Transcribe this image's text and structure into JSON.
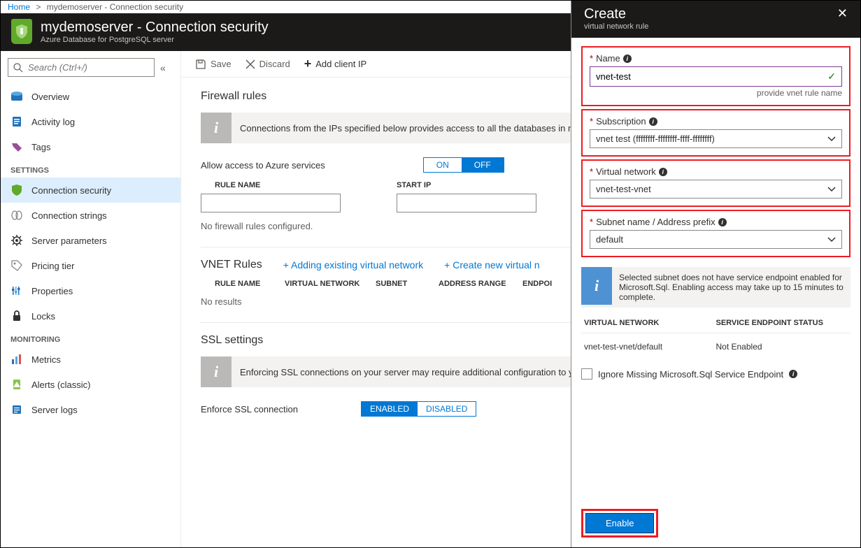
{
  "breadcrumb": {
    "home": "Home",
    "sep": ">",
    "current": "mydemoserver - Connection security"
  },
  "header": {
    "title": "mydemoserver - Connection security",
    "subtitle": "Azure Database for PostgreSQL server"
  },
  "search": {
    "placeholder": "Search (Ctrl+/)"
  },
  "nav": {
    "overview": "Overview",
    "activity": "Activity log",
    "tags": "Tags",
    "section_settings": "SETTINGS",
    "conn_sec": "Connection security",
    "conn_str": "Connection strings",
    "server_params": "Server parameters",
    "pricing": "Pricing tier",
    "properties": "Properties",
    "locks": "Locks",
    "section_monitoring": "MONITORING",
    "metrics": "Metrics",
    "alerts": "Alerts (classic)",
    "server_logs": "Server logs"
  },
  "toolbar": {
    "save": "Save",
    "discard": "Discard",
    "add_ip": "Add client IP"
  },
  "fw": {
    "title": "Firewall rules",
    "info": "Connections from the IPs specified below provides access to all the databases in my",
    "allow_azure": "Allow access to Azure services",
    "on": "ON",
    "off": "OFF",
    "col_rule": "RULE NAME",
    "col_start": "START IP",
    "none": "No firewall rules configured."
  },
  "vnet": {
    "title": "VNET Rules",
    "add_existing": "Adding existing virtual network",
    "create_new": "Create new virtual n",
    "col_rule": "RULE NAME",
    "col_vn": "VIRTUAL NETWORK",
    "col_subnet": "SUBNET",
    "col_addr": "ADDRESS RANGE",
    "col_ep": "ENDPOI",
    "no_results": "No results"
  },
  "ssl": {
    "title": "SSL settings",
    "info": "Enforcing SSL connections on your server may require additional configuration to y",
    "enforce": "Enforce SSL connection",
    "enabled": "ENABLED",
    "disabled": "DISABLED"
  },
  "panel": {
    "title": "Create",
    "subtitle": "virtual network rule",
    "name_label": "Name",
    "name_value": "vnet-test",
    "name_helper": "provide vnet rule name",
    "sub_label": "Subscription",
    "sub_value": "vnet test (ffffffff-ffffffff-ffff-ffffffff)",
    "vn_label": "Virtual network",
    "vn_value": "vnet-test-vnet",
    "subnet_label": "Subnet name / Address prefix",
    "subnet_value": "default",
    "warn": "Selected subnet does not have service endpoint enabled for Microsoft.Sql. Enabling access may take up to 15 minutes to complete.",
    "tbl_vn": "VIRTUAL NETWORK",
    "tbl_status": "SERVICE ENDPOINT STATUS",
    "row_vn": "vnet-test-vnet/default",
    "row_status": "Not Enabled",
    "ignore": "Ignore Missing Microsoft.Sql Service Endpoint",
    "enable_btn": "Enable"
  }
}
